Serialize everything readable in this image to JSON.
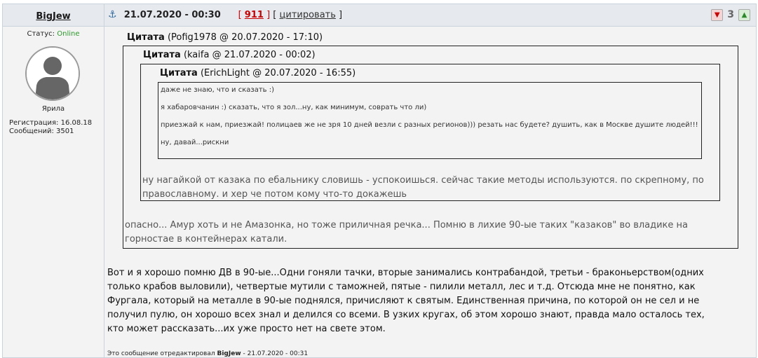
{
  "post": {
    "author": "BigJew",
    "date": "21.07.2020 - 00:30",
    "post_number": "911",
    "quote_action": "цитировать",
    "rating_value": "3",
    "icons": {
      "anchor": "anchor-icon",
      "down": "thumb-down-icon",
      "up": "thumb-up-icon"
    },
    "colors": {
      "online": "#2a9a2a",
      "post_number": "#cc0000"
    }
  },
  "sidebar": {
    "status_label": "Статус:",
    "status_value": "Online",
    "user_title": "Ярила",
    "registration": "Регистрация: 16.08.18",
    "messages": "Сообщений: 3501"
  },
  "quotes": {
    "label": "Цитата",
    "q1_meta": "(Pofig1978 @ 20.07.2020 - 17:10)",
    "q2_meta": "(kaifa @ 21.07.2020 - 00:02)",
    "q3_meta": "(ErichLight @ 20.07.2020 - 16:55)",
    "q3_lines": [
      "даже не знаю, что и сказать :)",
      "я хабаровчанин :) сказать, что я зол...ну, как минимум, соврать что ли)",
      "приезжай к нам, приезжай! полицаев же не зря 10 дней везли с разных регионов))) резать нас будете? душить, как в Москве душите людей!!!",
      "ну, давай...рискни"
    ],
    "q2_text": "ну нагайкой от казака по ебальнику словишь - успокоишься. сейчас такие методы используются. по скрепному, по православному. и хер че потом кому что-то докажешь",
    "q1_text": "опасно... Амур хоть и не Амазонка, но тоже приличная речка... Помню в лихие 90-ые таких \"казаков\" во владике на горностае в контейнерах катали."
  },
  "body_text": "Вот и я хорошо помню ДВ в 90-ые...Одни гоняли тачки, вторые занимались контрабандой, третьи - браконьерством(одних только крабов выловили), четвертые мутили с таможней, пятые - пилили металл, лес и т.д. Отсюда мне не понятно, как Фургала, который на металле в 90-ые поднялся, причисляют к святым. Единственная причина, по которой он не сел и не получил пулю, он хорошо всех знал и делился со всеми. В узких кругах, об этом хорошо знают, правда мало осталось тех, кто может рассказать...их уже просто нет на свете этом.",
  "edited": {
    "prefix": "Это сообщение отредактировал",
    "user": "BigJew",
    "suffix": "- 21.07.2020 - 00:31"
  }
}
